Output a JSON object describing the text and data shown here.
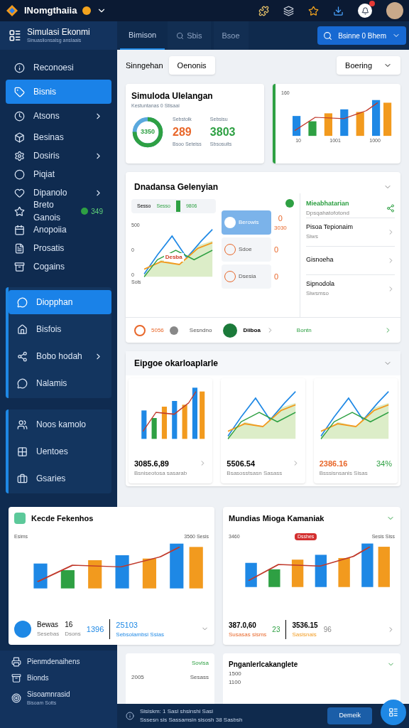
{
  "app_bar": {
    "title": "INomgthaiia"
  },
  "sidebar_header": {
    "title": "Simulasi Ekonmi",
    "subtitle": "Sinuaslionsalsg anslaais"
  },
  "tabs": [
    {
      "label": "Bimison",
      "selected": true,
      "kind": "tab"
    },
    {
      "label": "Sbis",
      "selected": false,
      "kind": "search"
    },
    {
      "label": "Bsoe",
      "selected": false,
      "kind": "tab"
    }
  ],
  "action_button": "Bsinne 0 Bhem",
  "sidebar": {
    "items": [
      {
        "label": "Reconoesi",
        "selected": false,
        "expandable": false
      },
      {
        "label": "Bisnis",
        "selected": true,
        "expandable": false
      },
      {
        "label": "Atsons",
        "selected": false,
        "expandable": true
      },
      {
        "label": "Besinas",
        "selected": false,
        "expandable": false
      },
      {
        "label": "Dosiris",
        "selected": false,
        "expandable": true
      },
      {
        "label": "Piqiat",
        "selected": false,
        "expandable": false
      },
      {
        "label": "Dipanolo",
        "selected": false,
        "expandable": true
      },
      {
        "label": "Breto Ganois",
        "selected": false,
        "expandable": false,
        "badge": "349"
      },
      {
        "label": "Anopoiia",
        "selected": false,
        "expandable": false
      },
      {
        "label": "Prosatis",
        "selected": false,
        "expandable": false
      },
      {
        "label": "Cogains",
        "selected": false,
        "expandable": false
      }
    ],
    "groups": [
      {
        "items": [
          {
            "label": "Diopphan",
            "selected": true,
            "expandable": false
          },
          {
            "label": "Bisfois",
            "selected": false,
            "expandable": false
          },
          {
            "label": "Bobo hodah",
            "selected": false,
            "expandable": true
          },
          {
            "label": "Nalamis",
            "selected": false,
            "expandable": false
          }
        ]
      },
      {
        "items": [
          {
            "label": "Noos kamolo",
            "selected": false,
            "expandable": false
          },
          {
            "label": "Uentoes",
            "selected": false,
            "expandable": false
          },
          {
            "label": "Gsaries",
            "selected": false,
            "expandable": false
          }
        ]
      }
    ],
    "bottom_items": [
      {
        "label": "Pienmdenaihens"
      },
      {
        "label": "Bionds"
      },
      {
        "label": "Sisoamnrasid",
        "sub": "Bisoam Sotts"
      }
    ]
  },
  "toolbar": {
    "label": "Sinngehan",
    "chip": "Oenonis",
    "dropdown": "Boering"
  },
  "summary_card": {
    "title": "Simuloda Ulelangan",
    "subtitle": "Kestuntanas 0 Stisaai",
    "donut_label": "3350",
    "level": 0.75,
    "stats": [
      {
        "label": "Sebstolk",
        "value": "289",
        "caption": "Bsoo Seteiss",
        "color": "#e8672a"
      },
      {
        "label": "Sebsisu",
        "value": "3803",
        "caption": "Sbsosuits",
        "color": "#2ea043"
      }
    ]
  },
  "trend_card": {
    "labels": [
      "160",
      "10",
      "1001",
      "1000"
    ]
  },
  "panel": {
    "title": "Dnadansa Gelenyian",
    "filter": [
      "Sesso",
      "Sesso",
      "9806"
    ],
    "chart_labels": [
      "500",
      "0",
      "0",
      "Sols"
    ],
    "annotation": "Desba",
    "popover": [
      {
        "label": "Berowis",
        "value": "0",
        "sub": "3030",
        "selected": true
      },
      {
        "label": "Sdoe",
        "value": "0",
        "selected": false
      },
      {
        "label": "Dsesia",
        "value": "0",
        "selected": false
      }
    ],
    "list_header": {
      "title": "Mieabhatarian",
      "sub": "Dpsqahatofotond"
    },
    "list": [
      {
        "title": "Pisoa Tepionaim",
        "sub": "Siws"
      },
      {
        "title": "Gisnoeha"
      },
      {
        "title": "Sipnodola",
        "sub": "Siwsmso"
      }
    ],
    "footer": {
      "value": "5056",
      "text": "Sesndno",
      "item": "Diiboa",
      "link": "Bontn"
    }
  },
  "section": {
    "title": "Eipgoe okarloaplarle",
    "cards": [
      {
        "kind": "bars",
        "value": "3085.6,89",
        "caption": "Bsniseotosa sasarab"
      },
      {
        "kind": "lines",
        "value": "5506.54",
        "caption": "Bsasosstsasn Sasass"
      },
      {
        "kind": "lines",
        "value": "2386.16",
        "caption": "Bsssisnsanis Sisas",
        "percent": "34%"
      }
    ]
  },
  "band": {
    "icon_title": "Kecde Fekenhos",
    "title": "Mundias Mioga Kamaniak",
    "left": {
      "labels": [
        "Esims",
        "3560 Sesis"
      ],
      "name": "Bewas",
      "name_sub": "Sesebas",
      "count": "16",
      "count_sub": "Dsons",
      "percent": "1396",
      "amount": "25103",
      "amount_sub": "Sebsolambsi Ssias"
    },
    "right": {
      "labels": [
        "3460",
        "Sesis Siss"
      ],
      "tag": "Dsshes",
      "amount": "387.0,60",
      "amount_sub": "Susasas sisms",
      "delta": "23",
      "amount2": "3536.15",
      "amount2_sub": "Sasisnais",
      "delta2": "96"
    }
  },
  "bottom": {
    "left_label": "Sovisa",
    "left_ticks": [
      "2005",
      "Sesass"
    ],
    "right_title": "Pnganlerlcakanglete",
    "right_ticks": [
      "1500",
      "1100"
    ]
  },
  "status_bar": {
    "lines": [
      "Sisiskm: 1 Sasl shsinshi Sasi",
      "Sssesn sis Sassamsin sisosh 38 Sasbsh"
    ],
    "button": "Demeik"
  }
}
